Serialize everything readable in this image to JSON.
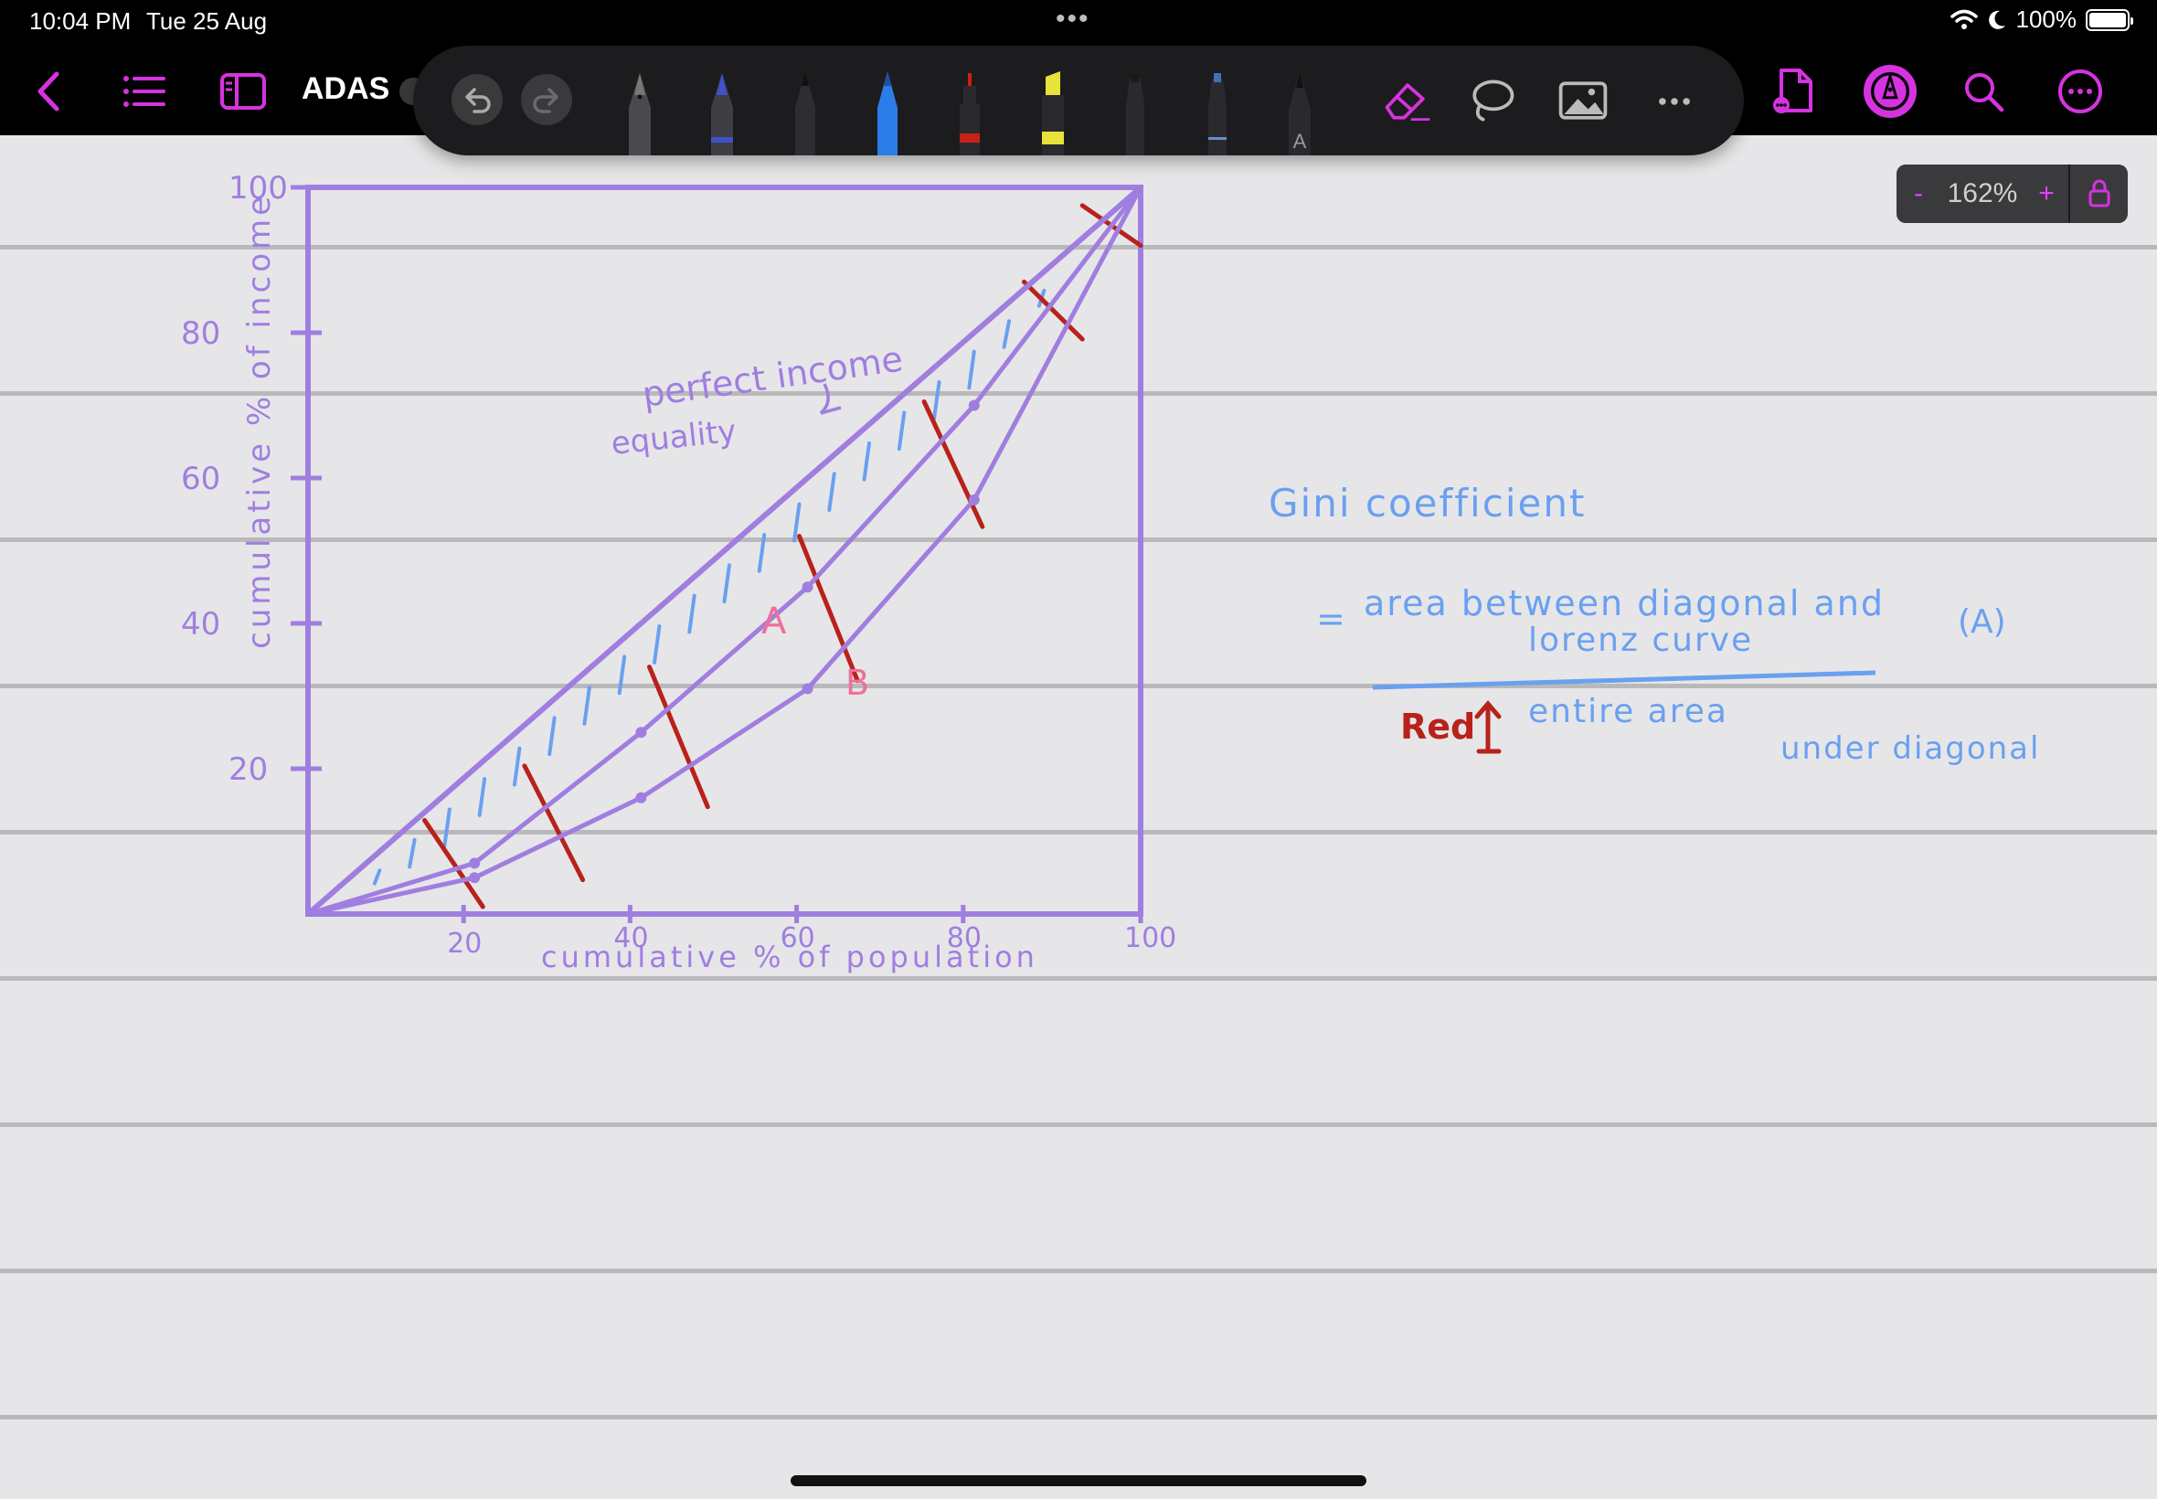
{
  "status_bar": {
    "time": "10:04 PM",
    "date": "Tue 25 Aug",
    "dots": "•••",
    "battery": "100%"
  },
  "nav": {
    "doc_title": "ADAS",
    "icons": [
      "back-chevron-icon",
      "list-icon",
      "sidebar-icon",
      "new-page-icon",
      "pen-mode-icon",
      "search-icon",
      "more-icon"
    ]
  },
  "toolbar": {
    "tools": [
      "undo-icon",
      "redo-icon",
      "fountain-pen-tool",
      "fountain-pen-blue-tool",
      "ballpoint-pen-tool",
      "ballpoint-blue-tool",
      "fineliner-red-tool",
      "highlighter-yellow-tool",
      "marker-black-tool",
      "marker-blue-tool",
      "pencil-tool",
      "eraser-icon",
      "lasso-icon",
      "image-icon",
      "more-icon"
    ]
  },
  "zoom": {
    "minus": "-",
    "value": "162%",
    "plus": "+"
  },
  "colors": {
    "accent": "#d633e0",
    "chart_purple": "#a07ee0",
    "note_blue": "#6aa0f0",
    "red_ink": "#b8221a",
    "pink_label": "#ee6f9a"
  },
  "notes": {
    "chart_annotation_line1": "perfect income",
    "chart_annotation_line2": "equality",
    "region_a": "A",
    "region_b": "B",
    "gini_title": "Gini coefficient",
    "equals": "=",
    "numerator_line1": "area between diagonal and",
    "numerator_line2": "lorenz curve",
    "numerator_tag": "(A)",
    "red_label": "Red",
    "denominator_line1": "entire area",
    "denominator_line2": "under diagonal"
  },
  "chart_data": {
    "type": "line",
    "title": "",
    "xlabel": "cumulative % of population",
    "ylabel": "cumulative % of income",
    "x_ticks": [
      "20",
      "40",
      "60",
      "80",
      "100"
    ],
    "y_ticks": [
      "100",
      "80",
      "60",
      "40",
      "20"
    ],
    "xlim": [
      0,
      100
    ],
    "ylim": [
      0,
      100
    ],
    "series": [
      {
        "name": "",
        "x": [
          0,
          100
        ],
        "y": [
          0,
          100
        ]
      },
      {
        "name": "",
        "x": [
          0,
          20,
          40,
          60,
          80,
          100
        ],
        "y": [
          0,
          7,
          25,
          45,
          70,
          100
        ]
      },
      {
        "name": "",
        "x": [
          0,
          20,
          40,
          60,
          80,
          100
        ],
        "y": [
          0,
          5,
          16,
          31,
          57,
          100
        ]
      }
    ]
  }
}
